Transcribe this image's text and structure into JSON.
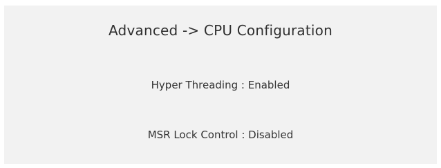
{
  "breadcrumb": {
    "title": "Advanced -> CPU Configuration"
  },
  "settings": [
    {
      "name": "Hyper Threading",
      "separator": " : ",
      "value": "Enabled"
    },
    {
      "name": "MSR Lock Control",
      "separator": " : ",
      "value": "Disabled"
    }
  ]
}
